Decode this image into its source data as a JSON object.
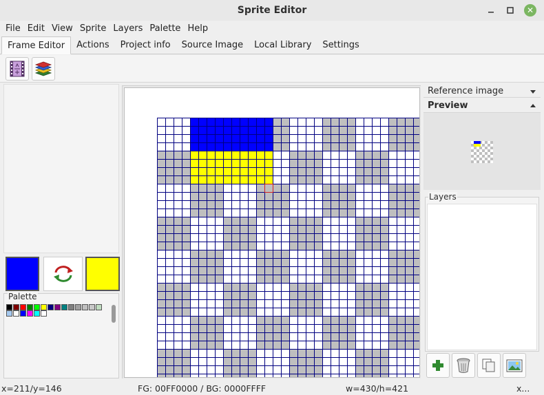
{
  "window": {
    "title": "Sprite Editor"
  },
  "menubar": {
    "items": [
      "File",
      "Edit",
      "View",
      "Sprite",
      "Layers",
      "Palette",
      "Help"
    ]
  },
  "tabs": {
    "items": [
      "Frame Editor",
      "Actions",
      "Project info",
      "Source Image",
      "Local Library",
      "Settings"
    ],
    "active": "Frame Editor"
  },
  "toolbar": {
    "icons": [
      "film-frames-icon",
      "layers-stack-icon"
    ]
  },
  "colors": {
    "foreground": "#0000FF",
    "background": "#FFFF00",
    "checker_gray": "#BFBFBF",
    "grid_line": "#000080",
    "accent": "#7BB661"
  },
  "palette": {
    "label": "Palette",
    "rows": [
      [
        "#000000",
        "#800000",
        "#FF0000",
        "#008000",
        "#00FF00",
        "#FFFF00",
        "#000080",
        "#800080",
        "#008080",
        "#808080",
        "#A0A0A0",
        "#BFBFBF",
        "#C8C8C8",
        "#C0DCC0"
      ],
      [
        "#A6CAF0",
        "#FFFFFF",
        "#0000FF",
        "#FF00FF",
        "#00FFFF",
        "#FFFFFF"
      ]
    ]
  },
  "canvas": {
    "cols": 32,
    "rows": 32,
    "blue_rect": {
      "col": 4,
      "row": 0,
      "cols": 10,
      "rows": 4
    },
    "yellow_rect": {
      "col": 4,
      "row": 4,
      "cols": 10,
      "rows": 4
    },
    "cursor_cell": {
      "col": 13,
      "row": 8
    }
  },
  "right_panel": {
    "reference_label": "Reference image",
    "preview_label": "Preview",
    "layers_label": "Layers",
    "layer_buttons": [
      "add-layer-icon",
      "delete-layer-icon",
      "duplicate-layer-icon",
      "layer-image-icon"
    ]
  },
  "status": {
    "coords": "x=211/y=146",
    "colors": "FG: 00FF0000 / BG: 0000FFFF",
    "size": "w=430/h=421",
    "extra": "x..."
  }
}
